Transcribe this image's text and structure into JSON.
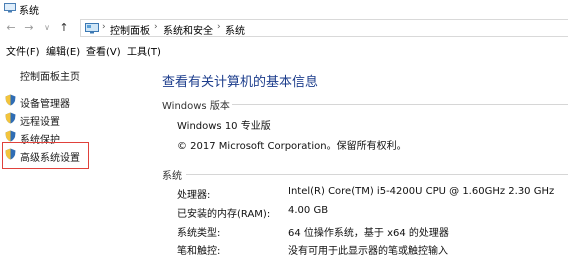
{
  "window": {
    "title": "系统"
  },
  "address": {
    "crumbs": [
      "控制面板",
      "系统和安全",
      "系统"
    ]
  },
  "menu": [
    "文件(F)",
    "编辑(E)",
    "查看(V)",
    "工具(T)"
  ],
  "sidebar": {
    "home": "控制面板主页",
    "items": [
      "设备管理器",
      "远程设置",
      "系统保护",
      "高级系统设置"
    ]
  },
  "main": {
    "title": "查看有关计算机的基本信息",
    "windows_section": {
      "heading": "Windows 版本",
      "edition": "Windows 10 专业版",
      "copyright": "© 2017 Microsoft Corporation。保留所有权利。"
    },
    "system_section": {
      "heading": "系统",
      "rows": [
        {
          "label": "处理器:",
          "value": "Intel(R) Core(TM) i5-4200U CPU @ 1.60GHz   2.30 GHz"
        },
        {
          "label": "已安装的内存(RAM):",
          "value": "4.00 GB"
        },
        {
          "label": "系统类型:",
          "value": "64 位操作系统，基于 x64 的处理器"
        },
        {
          "label": "笔和触控:",
          "value": "没有可用于此显示器的笔或触控输入"
        }
      ]
    }
  },
  "colors": {
    "title_blue": "#1c3d8c",
    "highlight_red": "#e0413b"
  }
}
